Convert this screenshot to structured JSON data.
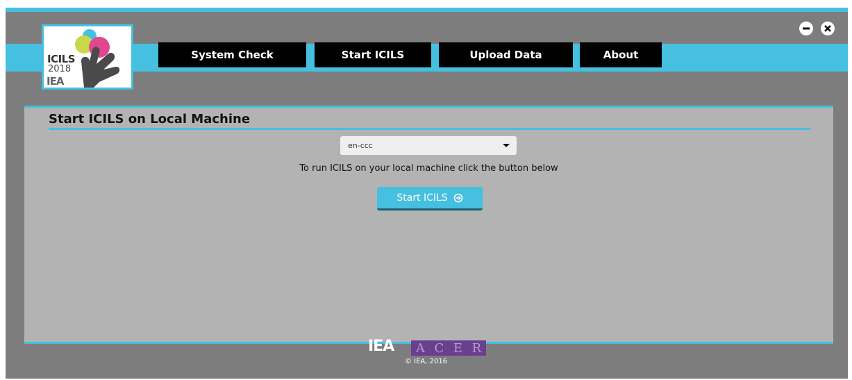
{
  "window": {
    "controls": [
      {
        "name": "minimize",
        "icon": "minus-circle-icon"
      },
      {
        "name": "close",
        "icon": "close-circle-icon"
      }
    ]
  },
  "logo": {
    "line1": "ICILS",
    "line2": "2018",
    "line3": "IEA"
  },
  "nav": {
    "items": [
      {
        "label": "System Check"
      },
      {
        "label": "Start ICILS"
      },
      {
        "label": "Upload Data"
      },
      {
        "label": "About"
      }
    ]
  },
  "main": {
    "title": "Start ICILS on Local Machine",
    "language_select": {
      "value": "en-ccc"
    },
    "instructions": "To run ICILS on your local machine click the button below",
    "start_button": {
      "label": "Start ICILS",
      "icon": "arrow-right-circle-icon"
    }
  },
  "footer": {
    "iea": "IEA",
    "acer": [
      "A",
      "C",
      "E",
      "R"
    ],
    "copyright": "© IEA, 2016"
  },
  "colors": {
    "accent": "#45c0e0",
    "frame": "#7d7d7d",
    "panel": "#b3b3b3",
    "nav_button": "#000000",
    "acer": "#6a3f8f"
  }
}
